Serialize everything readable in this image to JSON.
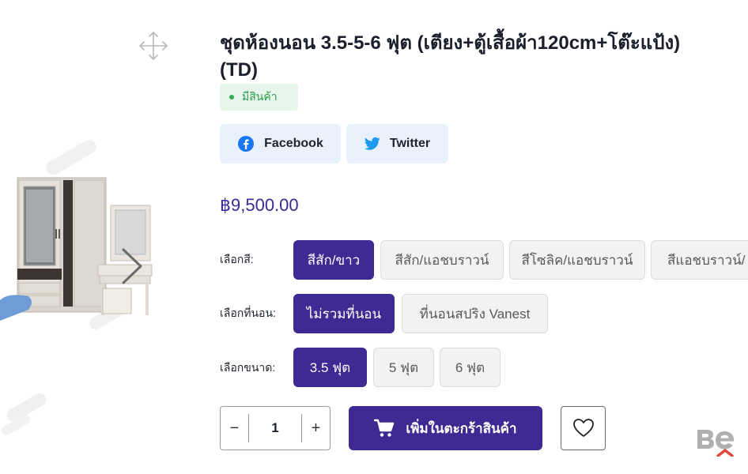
{
  "product": {
    "title_line1": "ชุดห้องนอน 3.5-5-6 ฟุต (เตียง+ตู้เสื้อผ้า120cm+โต๊ะแป้ง)",
    "title_line2": "(TD)",
    "stock_status": "มีสินค้า",
    "price": "฿9,500.00"
  },
  "share": {
    "facebook_label": "Facebook",
    "twitter_label": "Twitter"
  },
  "options": {
    "color": {
      "label": "เลือกสี:",
      "choices": [
        "สีสัก/ขาว",
        "สีสัก/แอชบราวน์",
        "สีโซลิค/แอชบราวน์",
        "สีแอชบราวน์/"
      ],
      "selected": "สีสัก/ขาว"
    },
    "mattress": {
      "label": "เลือกที่นอน:",
      "choices": [
        "ไม่รวมที่นอน",
        "ที่นอนสปริง Vanest"
      ],
      "selected": "ไม่รวมที่นอน"
    },
    "size": {
      "label": "เลือกขนาด:",
      "choices": [
        "3.5 ฟุต",
        "5 ฟุต",
        "6 ฟุต"
      ],
      "selected": "3.5 ฟุต"
    }
  },
  "cart": {
    "quantity": "1",
    "minus": "−",
    "plus": "+",
    "add_to_cart_label": "เพิ่มในตะกร้าสินค้า"
  },
  "icons": {
    "expand": "expand-arrows-icon",
    "next": "chevron-right-icon",
    "facebook": "facebook-icon",
    "twitter": "twitter-icon",
    "cart": "shopping-cart-icon",
    "wishlist": "heart-icon"
  },
  "colors": {
    "accent": "#3e2a92",
    "price": "#3a2a93",
    "in_stock_bg": "#e6f6ea",
    "in_stock_text": "#2e9a4e",
    "share_bg": "#e9f1fd",
    "facebook": "#1877f2",
    "twitter": "#1d9bf0"
  }
}
